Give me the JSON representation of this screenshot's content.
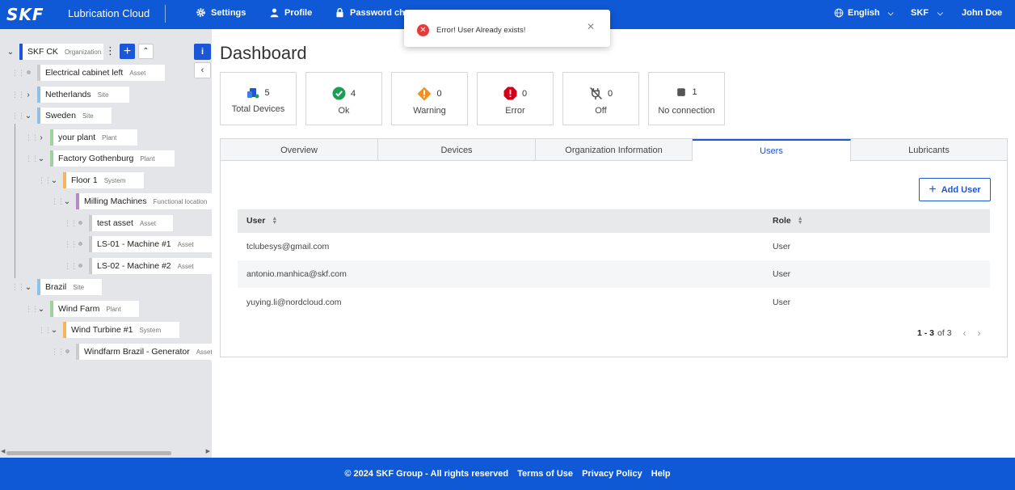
{
  "header": {
    "logo": "SKF",
    "app_title": "Lubrication Cloud",
    "nav": {
      "settings": "Settings",
      "profile": "Profile",
      "password": "Password cha"
    },
    "language": "English",
    "org": "SKF",
    "user": "John Doe"
  },
  "tree": {
    "org": {
      "name": "SKF CK",
      "type": "Organization"
    },
    "items": [
      {
        "name": "Electrical cabinet left",
        "type": "Asset"
      },
      {
        "name": "Netherlands",
        "type": "Site"
      },
      {
        "name": "Sweden",
        "type": "Site"
      },
      {
        "name": "your plant",
        "type": "Plant"
      },
      {
        "name": "Factory Gothenburg",
        "type": "Plant"
      },
      {
        "name": "Floor 1",
        "type": "System"
      },
      {
        "name": "Milling Machines",
        "type": "Functional location"
      },
      {
        "name": "test asset",
        "type": "Asset"
      },
      {
        "name": "LS-01 - Machine #1",
        "type": "Asset"
      },
      {
        "name": "LS-02 - Machine #2",
        "type": "Asset"
      },
      {
        "name": "Brazil",
        "type": "Site"
      },
      {
        "name": "Wind Farm",
        "type": "Plant"
      },
      {
        "name": "Wind Turbine #1",
        "type": "System"
      },
      {
        "name": "Windfarm Brazil - Generator",
        "type": "Asset"
      }
    ]
  },
  "dashboard": {
    "title": "Dashboard",
    "stats": [
      {
        "label": "Total Devices",
        "value": "5",
        "icon": "devices-icon"
      },
      {
        "label": "Ok",
        "value": "4",
        "icon": "check-circle-icon",
        "color": "#1f9d55"
      },
      {
        "label": "Warning",
        "value": "0",
        "icon": "warning-diamond-icon",
        "color": "#f0901e"
      },
      {
        "label": "Error",
        "value": "0",
        "icon": "error-octagon-icon",
        "color": "#d0021b"
      },
      {
        "label": "Off",
        "value": "0",
        "icon": "plug-off-icon"
      },
      {
        "label": "No connection",
        "value": "1",
        "icon": "square-icon"
      }
    ],
    "tabs": [
      "Overview",
      "Devices",
      "Organization Information",
      "Users",
      "Lubricants"
    ],
    "active_tab": "Users",
    "add_user_label": "Add User",
    "table": {
      "columns": [
        "User",
        "Role"
      ],
      "rows": [
        {
          "user": "tclubesys@gmail.com",
          "role": "User"
        },
        {
          "user": "antonio.manhica@skf.com",
          "role": "User"
        },
        {
          "user": "yuying.li@nordcloud.com",
          "role": "User"
        }
      ]
    },
    "pagination": {
      "range": "1 - 3",
      "of": "of 3"
    }
  },
  "toast": {
    "message": "Error! User Already exists!"
  },
  "footer": {
    "copyright": "© 2024 SKF Group - All rights reserved",
    "terms": "Terms of Use",
    "privacy": "Privacy Policy",
    "help": "Help"
  },
  "colors": {
    "brand": "#0f58d6",
    "accent": "#1a56d6",
    "panel": "#e4e5e8"
  }
}
